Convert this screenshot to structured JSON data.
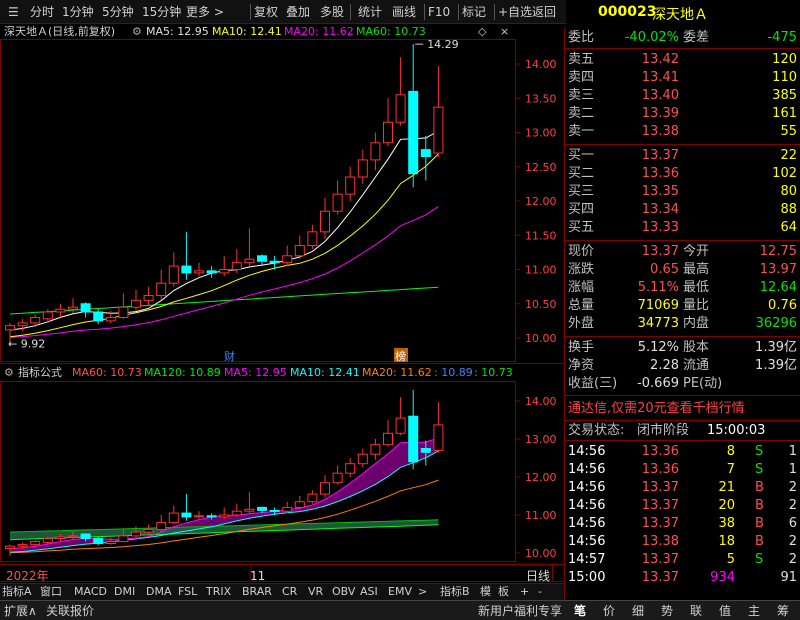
{
  "toolbar": {
    "items": [
      "分时",
      "1分钟",
      "5分钟",
      "15分钟",
      "更多 >",
      "复权",
      "叠加",
      "多股",
      "统计",
      "画线",
      "F10",
      "标记",
      "+自选",
      "返回"
    ]
  },
  "stock": {
    "code": "000023",
    "name": "深天地Ａ"
  },
  "main_header": {
    "title": "深天地Ａ(日线,前复权)",
    "ma5": "MA5: 12.95",
    "ma10": "MA10: 12.41",
    "ma20": "MA20: 11.62",
    "ma60": "MA60: 10.73"
  },
  "main_axis": [
    "14.00",
    "13.50",
    "13.00",
    "12.50",
    "12.00",
    "11.50",
    "11.00",
    "10.50",
    "10.00"
  ],
  "main_marks": {
    "high": "14.29",
    "low": "9.92",
    "cai": "财",
    "bang": "榜"
  },
  "sub_header": {
    "title": "指标公式",
    "ma60": "MA60: 10.73",
    "ma120": "MA120: 10.89",
    "ma5": "MA5: 12.95",
    "ma10": "MA10: 12.41",
    "ma20": "MA20: 11.62",
    "v1": ": 10.89",
    "v2": ": 10.73"
  },
  "sub_axis": [
    "14.00",
    "13.00",
    "12.00",
    "11.00",
    "10.00"
  ],
  "time_axis": {
    "left": "2022年",
    "mid": "11",
    "right_label": "日线"
  },
  "bottom_tabs": [
    "指标A",
    "窗口",
    "MACD",
    "DMI",
    "DMA",
    "FSL",
    "TRIX",
    "BRAR",
    "CR",
    "VR",
    "OBV",
    "ASI",
    "EMV",
    ">",
    "指标B",
    "模",
    "板"
  ],
  "status": {
    "left1": "扩展∧",
    "left2": "关联报价",
    "welfare": "新用户福利专享",
    "tabs": [
      "笔",
      "价",
      "细",
      "势",
      "联",
      "值",
      "主",
      "筹"
    ]
  },
  "quote": {
    "weibi_l": "委比",
    "weibi_v": "-40.02%",
    "weicha_l": "委差",
    "weicha_v": "-475",
    "sell": [
      {
        "label": "卖五",
        "price": "13.42",
        "vol": "120"
      },
      {
        "label": "卖四",
        "price": "13.41",
        "vol": "110"
      },
      {
        "label": "卖三",
        "price": "13.40",
        "vol": "385"
      },
      {
        "label": "卖二",
        "price": "13.39",
        "vol": "161"
      },
      {
        "label": "卖一",
        "price": "13.38",
        "vol": "55"
      }
    ],
    "buy": [
      {
        "label": "买一",
        "price": "13.37",
        "vol": "22"
      },
      {
        "label": "买二",
        "price": "13.36",
        "vol": "102"
      },
      {
        "label": "买三",
        "price": "13.35",
        "vol": "80"
      },
      {
        "label": "买四",
        "price": "13.34",
        "vol": "88"
      },
      {
        "label": "买五",
        "price": "13.33",
        "vol": "64"
      }
    ],
    "stats": [
      {
        "l1": "现价",
        "v1": "13.37",
        "l2": "今开",
        "v2": "12.75"
      },
      {
        "l1": "涨跌",
        "v1": "0.65",
        "l2": "最高",
        "v2": "13.97"
      },
      {
        "l1": "涨幅",
        "v1": "5.11%",
        "l2": "最低",
        "v2": "12.64"
      },
      {
        "l1": "总量",
        "v1": "71069",
        "l2": "量比",
        "v2": "0.76"
      },
      {
        "l1": "外盘",
        "v1": "34773",
        "l2": "内盘",
        "v2": "36296"
      }
    ],
    "stats2": [
      {
        "l1": "换手",
        "v1": "5.12%",
        "l2": "股本",
        "v2": "1.39亿"
      },
      {
        "l1": "净资",
        "v1": "2.28",
        "l2": "流通",
        "v2": "1.39亿"
      },
      {
        "l1": "收益(三)",
        "v1": "-0.669",
        "l2": "PE(动)",
        "v2": ""
      }
    ],
    "ad": "通达信,仅需20元查看千档行情",
    "trade_state_label": "交易状态:",
    "trade_state": "闭市阶段",
    "trade_time": "15:00:03",
    "ticks": [
      {
        "t": "14:56",
        "p": "13.36",
        "v": "8",
        "d": "S",
        "n": "1"
      },
      {
        "t": "14:56",
        "p": "13.36",
        "v": "7",
        "d": "S",
        "n": "1"
      },
      {
        "t": "14:56",
        "p": "13.37",
        "v": "21",
        "d": "B",
        "n": "2"
      },
      {
        "t": "14:56",
        "p": "13.37",
        "v": "20",
        "d": "B",
        "n": "2"
      },
      {
        "t": "14:56",
        "p": "13.37",
        "v": "38",
        "d": "B",
        "n": "6"
      },
      {
        "t": "14:56",
        "p": "13.38",
        "v": "18",
        "d": "B",
        "n": "2"
      },
      {
        "t": "14:57",
        "p": "13.37",
        "v": "5",
        "d": "S",
        "n": "2"
      },
      {
        "t": "15:00",
        "p": "13.37",
        "v": "934",
        "d": "",
        "n": "91"
      }
    ]
  },
  "colors": {
    "up": "#ff3030",
    "down": "#00ffff",
    "ma5": "#ffffff",
    "ma10": "#ffff00",
    "ma20": "#ff00ff",
    "ma60": "#00ff00"
  },
  "candles": [
    [
      10.12,
      10.18,
      10.22,
      9.92
    ],
    [
      10.18,
      10.22,
      10.28,
      10.1
    ],
    [
      10.22,
      10.3,
      10.34,
      10.16
    ],
    [
      10.28,
      10.38,
      10.42,
      10.22
    ],
    [
      10.38,
      10.42,
      10.5,
      10.3
    ],
    [
      10.42,
      10.45,
      10.58,
      10.36
    ],
    [
      10.5,
      10.38,
      10.52,
      10.3
    ],
    [
      10.38,
      10.25,
      10.42,
      10.2
    ],
    [
      10.25,
      10.3,
      10.4,
      10.22
    ],
    [
      10.3,
      10.45,
      10.65,
      10.28
    ],
    [
      10.45,
      10.55,
      10.7,
      10.4
    ],
    [
      10.55,
      10.62,
      10.75,
      10.48
    ],
    [
      10.62,
      10.8,
      11.0,
      10.55
    ],
    [
      10.8,
      11.05,
      11.25,
      10.75
    ],
    [
      11.05,
      10.95,
      11.55,
      10.85
    ],
    [
      10.95,
      10.98,
      11.1,
      10.9
    ],
    [
      10.98,
      10.95,
      11.05,
      10.88
    ],
    [
      10.95,
      11.0,
      11.2,
      10.9
    ],
    [
      11.0,
      11.1,
      11.3,
      10.95
    ],
    [
      11.1,
      11.15,
      11.6,
      11.05
    ],
    [
      11.2,
      11.12,
      11.22,
      11.05
    ],
    [
      11.12,
      11.1,
      11.2,
      11.0
    ],
    [
      11.1,
      11.2,
      11.35,
      11.05
    ],
    [
      11.2,
      11.35,
      11.5,
      11.15
    ],
    [
      11.35,
      11.55,
      11.65,
      11.3
    ],
    [
      11.55,
      11.85,
      12.05,
      11.45
    ],
    [
      11.85,
      12.1,
      12.3,
      11.8
    ],
    [
      12.1,
      12.35,
      12.5,
      12.0
    ],
    [
      12.35,
      12.6,
      12.75,
      12.25
    ],
    [
      12.6,
      12.85,
      13.0,
      12.45
    ],
    [
      12.85,
      13.15,
      13.5,
      12.8
    ],
    [
      13.15,
      13.55,
      14.1,
      13.1
    ],
    [
      13.6,
      12.4,
      14.29,
      12.2
    ],
    [
      12.75,
      12.65,
      12.95,
      12.3
    ],
    [
      12.7,
      13.37,
      13.97,
      12.64
    ]
  ]
}
